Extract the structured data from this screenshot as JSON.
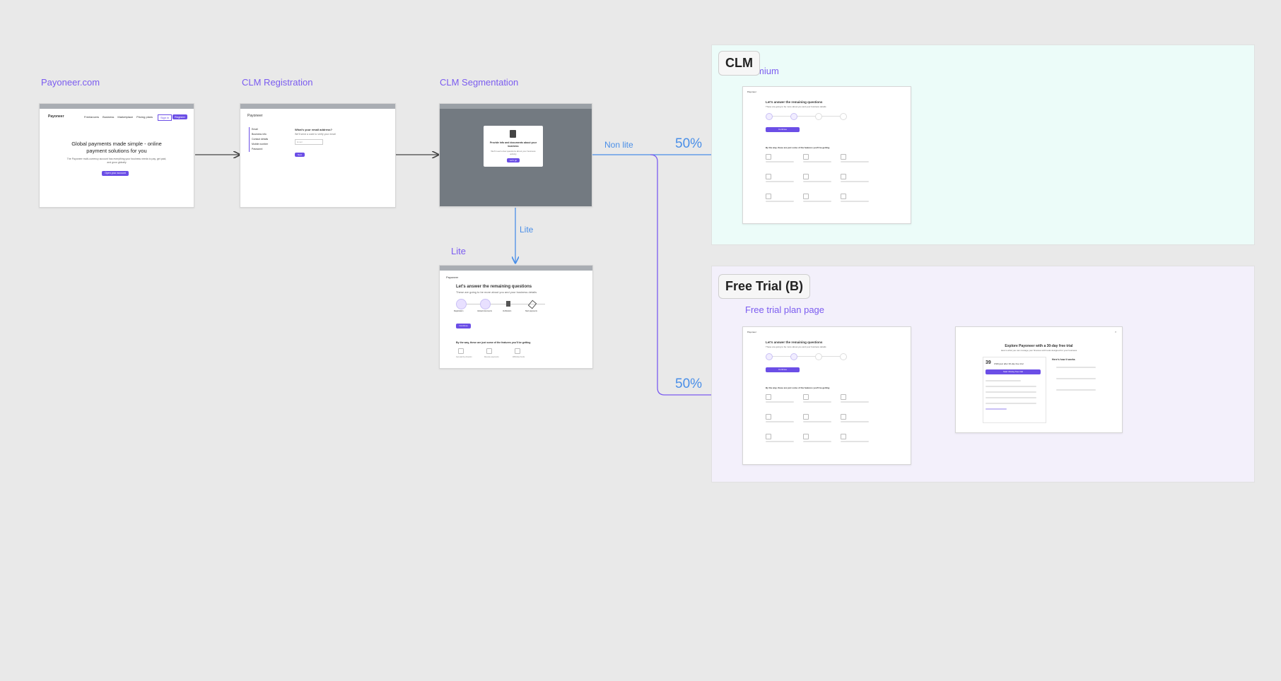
{
  "labels": {
    "payoneer": "Payoneer.com",
    "clm_registration": "CLM Registration",
    "clm_segmentation": "CLM Segmentation",
    "lite_frame": "Lite",
    "lite_arrow": "Lite",
    "non_lite": "Non lite",
    "pct_top": "50%",
    "pct_bottom": "50%",
    "premium_partial": "mium",
    "free_trial_plan": "Free trial plan page"
  },
  "sections": {
    "clm_tag": "CLM",
    "free_trial_tag": "Free Trial (B)"
  },
  "payoneer_home": {
    "logo": "Payoneer",
    "nav": [
      "Freelancers",
      "Business",
      "Marketplace",
      "Pricing plans"
    ],
    "sign_in": "Sign in",
    "register": "Register",
    "headline": "Global payments made simple - online payment solutions for you",
    "sub": "The Payoneer multi-currency account has everything your business needs to pay, get paid, and grow globally",
    "cta": "Open your account"
  },
  "registration": {
    "logo": "Payoneer",
    "steps": [
      "Email",
      "Business info",
      "Contact details",
      "Mobile number",
      "Password"
    ],
    "question": "What's your email address?",
    "hint": "We'll send a code to verify your email",
    "placeholder": "Email",
    "next": "Next"
  },
  "segmentation_modal": {
    "title": "Provide info and documents about your business",
    "body": "We'll need a few questions about your business activity",
    "button": "Let's go"
  },
  "lite_page": {
    "logo": "Payoneer",
    "title": "Let's answer the remaining questions",
    "sub": "These are going to be more about you and your business details",
    "steps": [
      "Registration",
      "Upload documents",
      "Verification",
      "Start payments"
    ],
    "continue": "Continue",
    "features_title": "By the way, these are just some of the features you'll be getting",
    "features": [
      "Get paid by Amazon",
      "Receive payments",
      "Withdraw funds"
    ]
  },
  "clm_page": {
    "logo": "Payoneer",
    "title": "Let's answer the remaining questions",
    "sub": "These are going to be more about you and your business details",
    "continue": "Continue",
    "features_title": "By the way, these are just some of the features you'll be getting"
  },
  "free_trial_page": {
    "title": "Explore Payoneer with a 30-day free trial",
    "sub": "Here's what you can manage your finances with tools designed for your business",
    "price": "39",
    "price_suffix": "USD/year after 30-day free trial",
    "cta": "Start 30-day free trial",
    "how_title": "Here's how it works"
  }
}
